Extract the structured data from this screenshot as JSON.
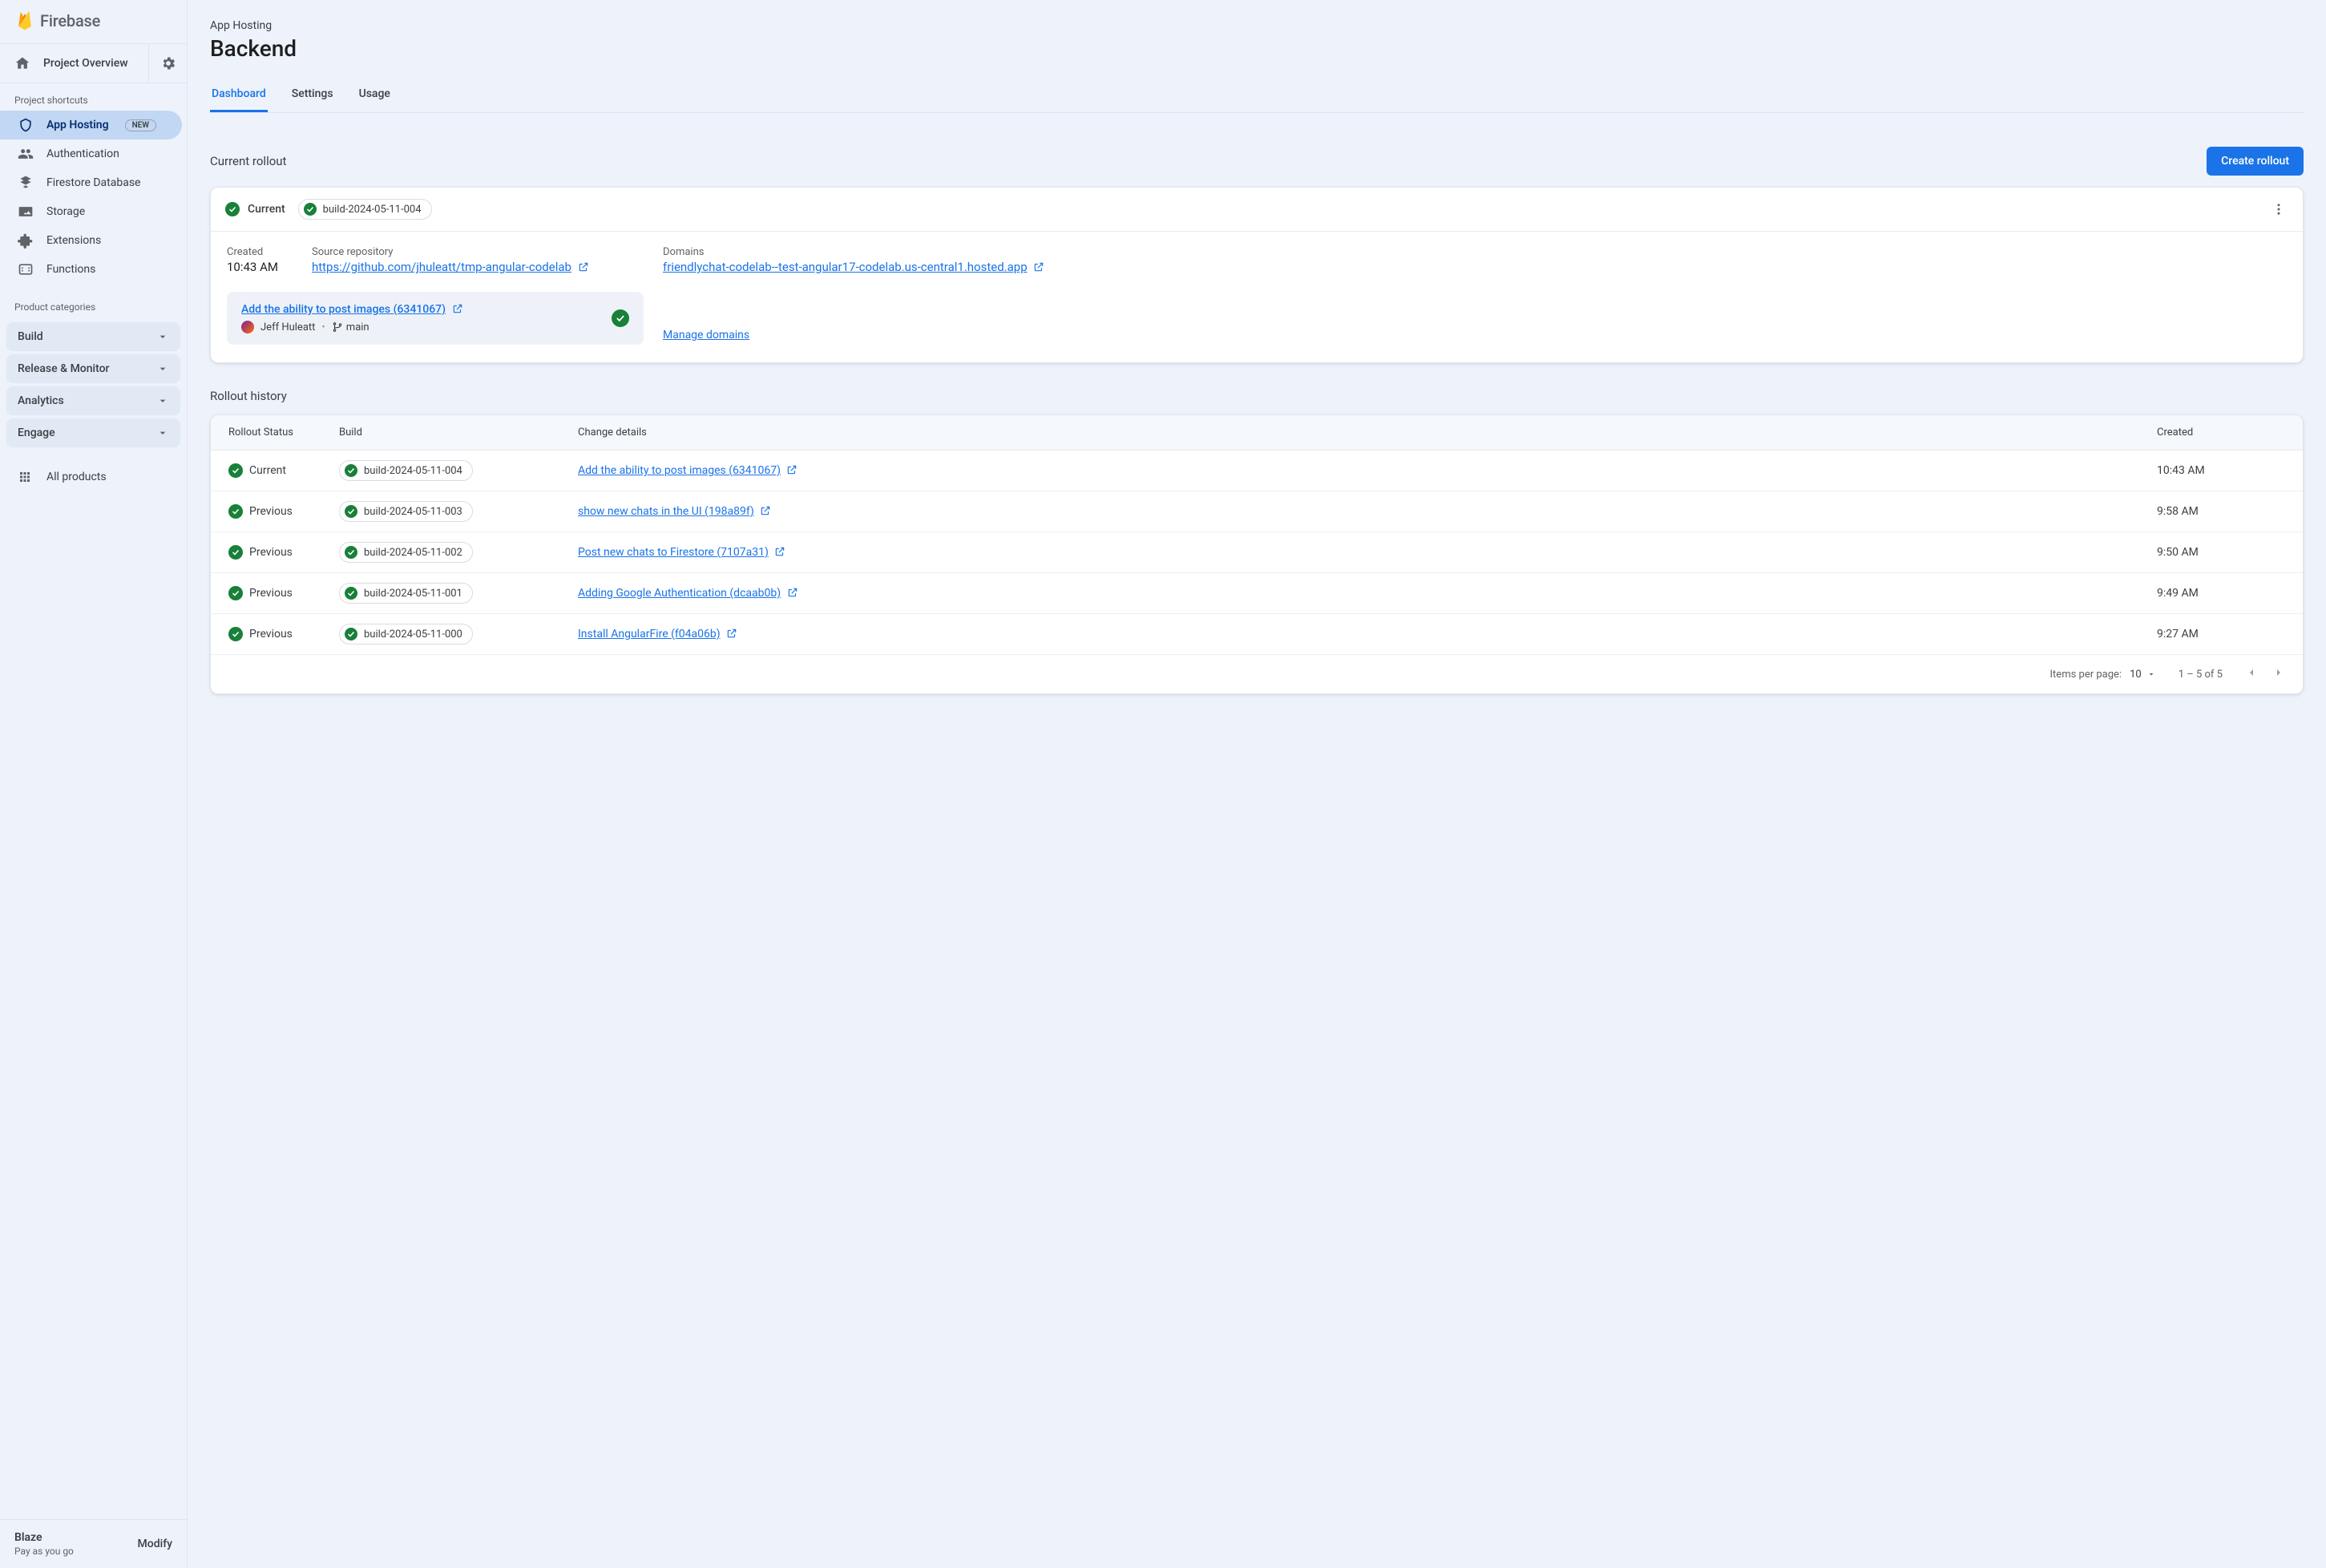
{
  "brand": {
    "name": "Firebase"
  },
  "sidebar": {
    "overview_label": "Project Overview",
    "shortcuts_title": "Project shortcuts",
    "items": [
      {
        "label": "App Hosting",
        "badge": "NEW",
        "active": true
      },
      {
        "label": "Authentication"
      },
      {
        "label": "Firestore Database"
      },
      {
        "label": "Storage"
      },
      {
        "label": "Extensions"
      },
      {
        "label": "Functions"
      }
    ],
    "categories_title": "Product categories",
    "categories": [
      {
        "label": "Build"
      },
      {
        "label": "Release & Monitor"
      },
      {
        "label": "Analytics"
      },
      {
        "label": "Engage"
      }
    ],
    "all_products_label": "All products",
    "plan": {
      "name": "Blaze",
      "sub": "Pay as you go",
      "action": "Modify"
    }
  },
  "header": {
    "breadcrumb": "App Hosting",
    "title": "Backend",
    "tabs": [
      {
        "label": "Dashboard",
        "active": true
      },
      {
        "label": "Settings"
      },
      {
        "label": "Usage"
      }
    ]
  },
  "current_rollout": {
    "section_title": "Current rollout",
    "create_button": "Create rollout",
    "status": "Current",
    "build": "build-2024-05-11-004",
    "created_label": "Created",
    "created_value": "10:43 AM",
    "repo_label": "Source repository",
    "repo_link": "https://github.com/jhuleatt/tmp-angular-codelab",
    "domains_label": "Domains",
    "domain_link": "friendlychat-codelab--test-angular17-codelab.us-central1.hosted.app",
    "commit": {
      "title": "Add the ability to post images (6341067)",
      "author": "Jeff Huleatt",
      "branch": "main"
    },
    "manage_domains_label": "Manage domains"
  },
  "history": {
    "section_title": "Rollout history",
    "columns": {
      "status": "Rollout Status",
      "build": "Build",
      "change": "Change details",
      "created": "Created"
    },
    "rows": [
      {
        "status": "Current",
        "build": "build-2024-05-11-004",
        "change": "Add the ability to post images (6341067)",
        "created": "10:43 AM"
      },
      {
        "status": "Previous",
        "build": "build-2024-05-11-003",
        "change": "show new chats in the UI (198a89f)",
        "created": "9:58 AM"
      },
      {
        "status": "Previous",
        "build": "build-2024-05-11-002",
        "change": "Post new chats to Firestore (7107a31)",
        "created": "9:50 AM"
      },
      {
        "status": "Previous",
        "build": "build-2024-05-11-001",
        "change": "Adding Google Authentication (dcaab0b)",
        "created": "9:49 AM"
      },
      {
        "status": "Previous",
        "build": "build-2024-05-11-000",
        "change": "Install AngularFire (f04a06b)",
        "created": "9:27 AM"
      }
    ],
    "footer": {
      "items_per_page_label": "Items per page:",
      "items_per_page_value": "10",
      "range_label": "1 – 5 of 5"
    }
  }
}
